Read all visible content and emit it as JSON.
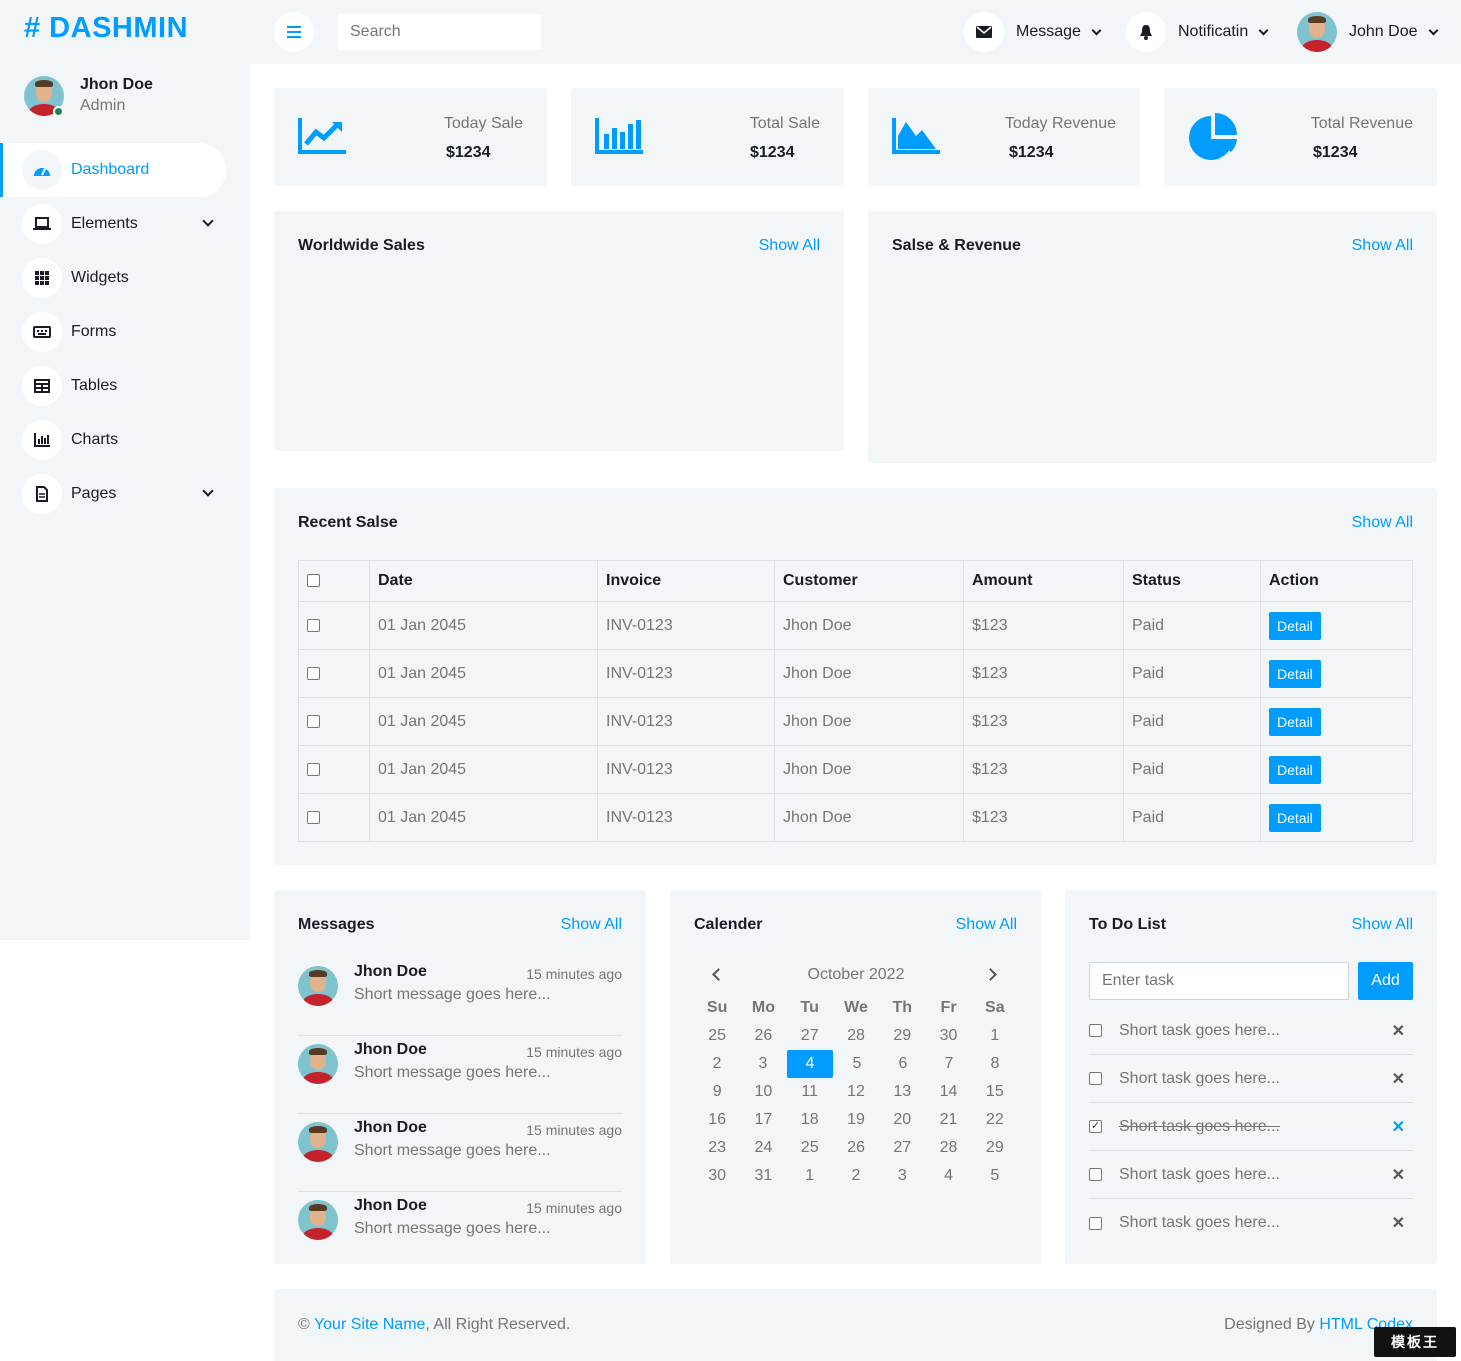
{
  "brand": "# DASHMIN",
  "sidebar": {
    "user_name": "Jhon Doe",
    "user_role": "Admin",
    "items": [
      {
        "label": "Dashboard",
        "icon": "dashboard-icon"
      },
      {
        "label": "Elements",
        "icon": "laptop-icon"
      },
      {
        "label": "Widgets",
        "icon": "grid-icon"
      },
      {
        "label": "Forms",
        "icon": "keyboard-icon"
      },
      {
        "label": "Tables",
        "icon": "table-icon"
      },
      {
        "label": "Charts",
        "icon": "chart-icon"
      },
      {
        "label": "Pages",
        "icon": "file-icon"
      }
    ]
  },
  "topbar": {
    "search_placeholder": "Search",
    "message_label": "Message",
    "notification_label": "Notificatin",
    "user_name": "John Doe"
  },
  "stats": [
    {
      "label": "Today Sale",
      "value": "$1234",
      "icon": "line-chart-icon"
    },
    {
      "label": "Total Sale",
      "value": "$1234",
      "icon": "bar-chart-icon"
    },
    {
      "label": "Today Revenue",
      "value": "$1234",
      "icon": "area-chart-icon"
    },
    {
      "label": "Total Revenue",
      "value": "$1234",
      "icon": "pie-chart-icon"
    }
  ],
  "show_all": "Show All",
  "worldwide": {
    "title": "Worldwide Sales"
  },
  "sales_revenue": {
    "title": "Salse & Revenue"
  },
  "recent": {
    "title": "Recent Salse",
    "headers": [
      "Date",
      "Invoice",
      "Customer",
      "Amount",
      "Status",
      "Action"
    ],
    "rows": [
      {
        "date": "01 Jan 2045",
        "invoice": "INV-0123",
        "customer": "Jhon Doe",
        "amount": "$123",
        "status": "Paid",
        "action": "Detail"
      },
      {
        "date": "01 Jan 2045",
        "invoice": "INV-0123",
        "customer": "Jhon Doe",
        "amount": "$123",
        "status": "Paid",
        "action": "Detail"
      },
      {
        "date": "01 Jan 2045",
        "invoice": "INV-0123",
        "customer": "Jhon Doe",
        "amount": "$123",
        "status": "Paid",
        "action": "Detail"
      },
      {
        "date": "01 Jan 2045",
        "invoice": "INV-0123",
        "customer": "Jhon Doe",
        "amount": "$123",
        "status": "Paid",
        "action": "Detail"
      },
      {
        "date": "01 Jan 2045",
        "invoice": "INV-0123",
        "customer": "Jhon Doe",
        "amount": "$123",
        "status": "Paid",
        "action": "Detail"
      }
    ]
  },
  "messages": {
    "title": "Messages",
    "items": [
      {
        "name": "Jhon Doe",
        "time": "15 minutes ago",
        "text": "Short message goes here..."
      },
      {
        "name": "Jhon Doe",
        "time": "15 minutes ago",
        "text": "Short message goes here..."
      },
      {
        "name": "Jhon Doe",
        "time": "15 minutes ago",
        "text": "Short message goes here..."
      },
      {
        "name": "Jhon Doe",
        "time": "15 minutes ago",
        "text": "Short message goes here..."
      }
    ]
  },
  "calendar": {
    "title": "Calender",
    "month": "October 2022",
    "weekdays": [
      "Su",
      "Mo",
      "Tu",
      "We",
      "Th",
      "Fr",
      "Sa"
    ],
    "weeks": [
      [
        "25",
        "26",
        "27",
        "28",
        "29",
        "30",
        "1"
      ],
      [
        "2",
        "3",
        "4",
        "5",
        "6",
        "7",
        "8"
      ],
      [
        "9",
        "10",
        "11",
        "12",
        "13",
        "14",
        "15"
      ],
      [
        "16",
        "17",
        "18",
        "19",
        "20",
        "21",
        "22"
      ],
      [
        "23",
        "24",
        "25",
        "26",
        "27",
        "28",
        "29"
      ],
      [
        "30",
        "31",
        "1",
        "2",
        "3",
        "4",
        "5"
      ]
    ],
    "selected": "4"
  },
  "todo": {
    "title": "To Do List",
    "placeholder": "Enter task",
    "add_label": "Add",
    "items": [
      {
        "text": "Short task goes here...",
        "done": false
      },
      {
        "text": "Short task goes here...",
        "done": false
      },
      {
        "text": "Short task goes here...",
        "done": true
      },
      {
        "text": "Short task goes here...",
        "done": false
      },
      {
        "text": "Short task goes here...",
        "done": false
      }
    ]
  },
  "footer": {
    "copyright_symbol": "©",
    "site_name": "Your Site Name",
    "rights": ", All Right Reserved.",
    "designed_by": "Designed By ",
    "designer": "HTML Codex"
  },
  "colors": {
    "primary": "#009cff",
    "panel": "#f3f6f9",
    "dark": "#191c24"
  }
}
